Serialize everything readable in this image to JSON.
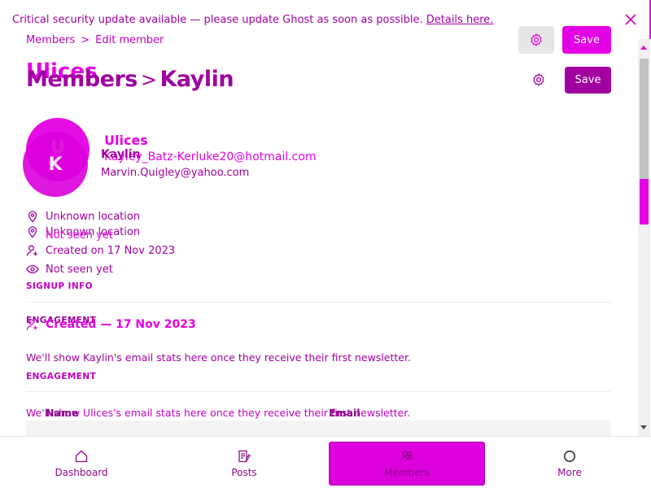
{
  "banner": {
    "message": "Critical security update available — please update Ghost as soon as possible.",
    "link": "Details here."
  },
  "breadcrumb": {
    "members": "Members",
    "separator": ">",
    "current": "Edit member"
  },
  "header": {
    "ghost_title": "Ulices",
    "title_section": "Members",
    "title_separator": ">",
    "title_member": "Kaylin",
    "save_label": "Save"
  },
  "member_ghost": {
    "initial": "U",
    "name": "Ulices",
    "email": "Kayley_Batz-Kerluke20@hotmail.com",
    "location": "Unknown location",
    "seen": "Not seen yet",
    "created": "Created — 17 Nov 2023",
    "engagement_label": "ENGAGEMENT",
    "engagement_text": "We'll show Ulices's email stats here once they receive their first newsletter.",
    "table_name": "Name",
    "table_email": "Email"
  },
  "member": {
    "initial": "K",
    "name": "Kaylin",
    "email": "Marvin.Quigley@yahoo.com",
    "location": "Unknown location",
    "created": "Created on 17 Nov 2023",
    "seen": "Not seen yet",
    "signup_label": "SIGNUP INFO",
    "engagement_label": "ENGAGEMENT",
    "engagement_text": "We'll show Kaylin's email stats here once they receive their first newsletter."
  },
  "nav": {
    "items": [
      {
        "label": "Dashboard",
        "icon": "home-icon"
      },
      {
        "label": "Posts",
        "icon": "posts-icon"
      },
      {
        "label": "Members",
        "icon": "members-icon"
      },
      {
        "label": "More",
        "icon": "more-icon"
      }
    ]
  },
  "colors": {
    "accent": "#e400e4",
    "primary": "#a000a0"
  }
}
